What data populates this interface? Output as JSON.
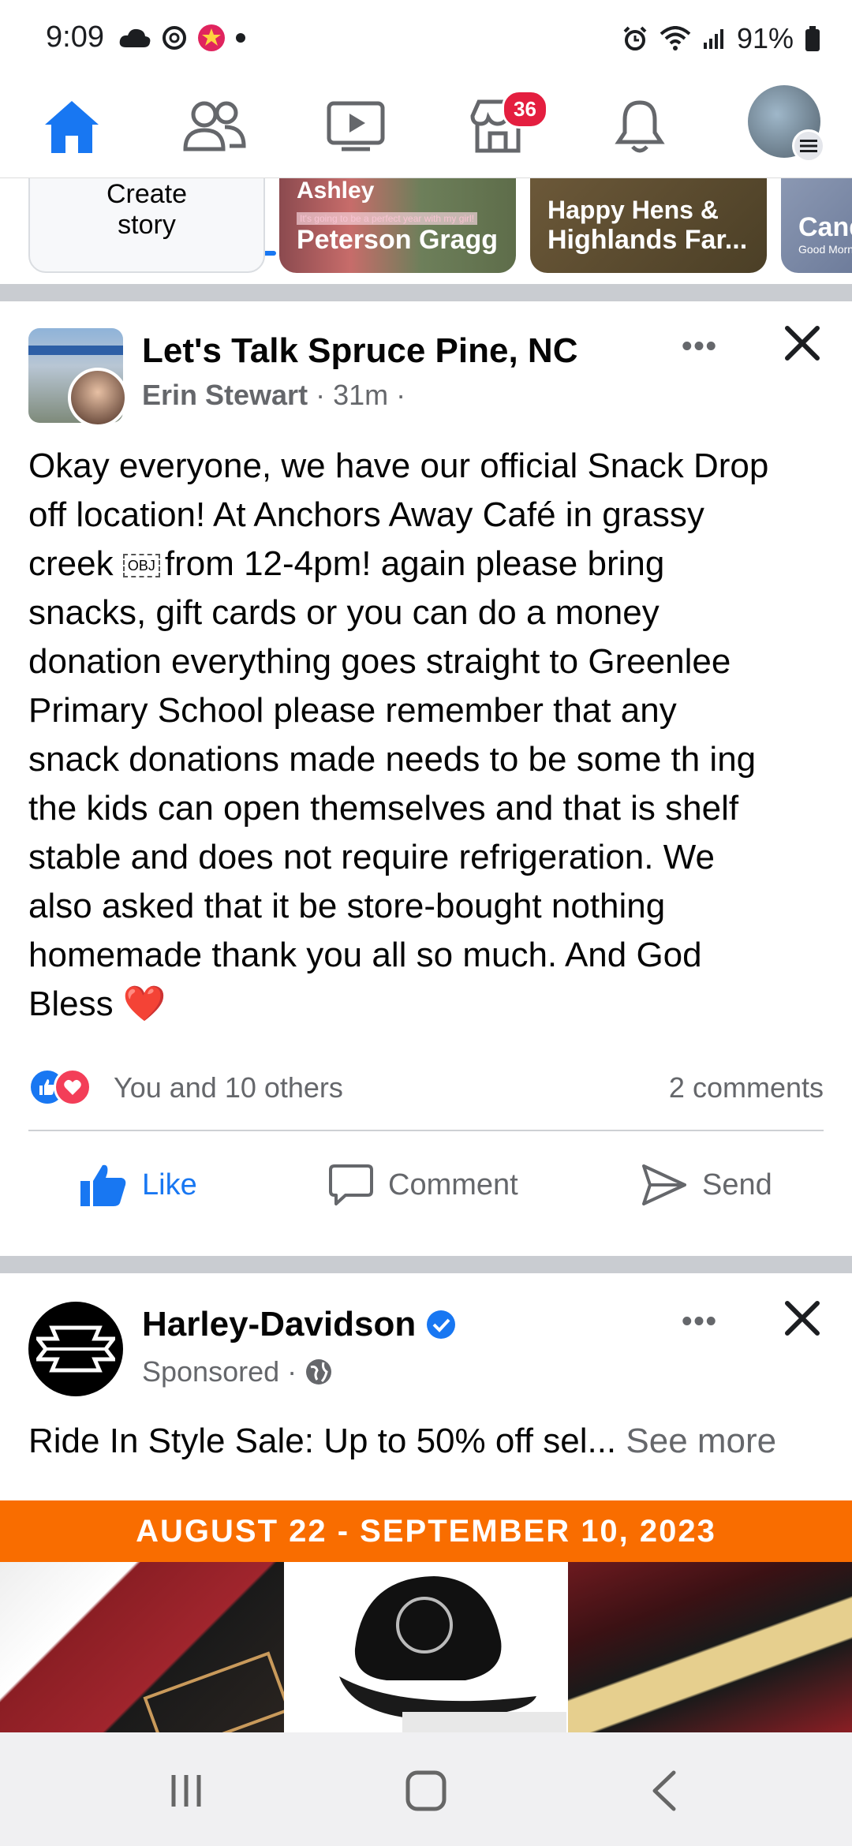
{
  "status_bar": {
    "time": "9:09",
    "battery": "91%"
  },
  "topnav": {
    "marketplace_badge": "36"
  },
  "stories": [
    {
      "line1": "Create",
      "line2": "story"
    },
    {
      "caption": "It's going to be a perfect year with my girl!",
      "name_top": "Ashley",
      "name": "Peterson Gragg"
    },
    {
      "name_top": "Happy Hens &",
      "name": "Highlands Far..."
    },
    {
      "name": "Cand",
      "caption": "Good Mornin"
    }
  ],
  "post": {
    "group": "Let's Talk Spruce Pine, NC",
    "author": "Erin Stewart",
    "time": "31m",
    "text_line1": "Okay everyone, we have our official Snack Drop",
    "text_line2": "off location! At Anchors Away Café in grassy",
    "text_line3a": "creek",
    "obj": "OBJ",
    "text_line3b": "from 12-4pm! again please bring",
    "text_line4": "snacks, gift cards or you can do a money",
    "text_line5": "donation everything goes straight to Greenlee",
    "text_line6": "Primary School please remember that any",
    "text_line7": "snack donations made needs to be some th ing",
    "text_line8": "the kids can open themselves and that is shelf",
    "text_line9": "stable and does not require refrigeration. We",
    "text_line10": "also asked that it be store-bought nothing",
    "text_line11": "homemade thank you all so much. And God",
    "text_line12": "Bless ❤️",
    "reactions": "You and 10 others",
    "comments": "2 comments",
    "like": "Like",
    "comment": "Comment",
    "send": "Send"
  },
  "sponsored": {
    "brand": "Harley-Davidson",
    "label": "Sponsored",
    "ad_text": "Ride In Style Sale: Up to 50% off sel...",
    "see_more": "See more",
    "promo": "AUGUST 22 - SEPTEMBER 10, 2023"
  },
  "colors": {
    "accent": "#1877f2",
    "promo": "#f96d00",
    "badge": "#e41e3f"
  }
}
